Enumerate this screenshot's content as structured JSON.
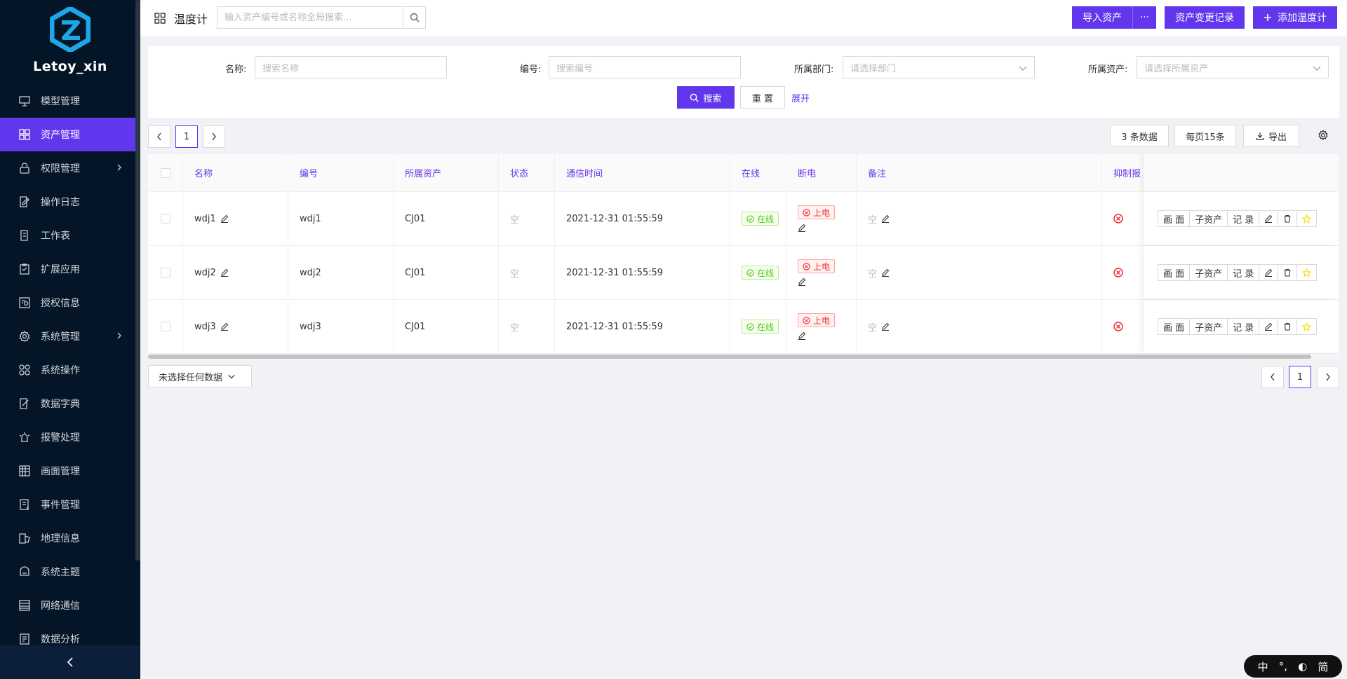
{
  "app": {
    "name": "Letoy_xin"
  },
  "sidebar": {
    "items": [
      {
        "label": "模型管理",
        "icon": "monitor-icon"
      },
      {
        "label": "资产管理",
        "icon": "grid-icon",
        "active": true
      },
      {
        "label": "权限管理",
        "icon": "lock-icon",
        "has_children": true
      },
      {
        "label": "操作日志",
        "icon": "edit-doc-icon"
      },
      {
        "label": "工作表",
        "icon": "sheet-icon"
      },
      {
        "label": "扩展应用",
        "icon": "clipboard-icon"
      },
      {
        "label": "授权信息",
        "icon": "license-icon"
      },
      {
        "label": "系统管理",
        "icon": "gear-icon",
        "has_children": true
      },
      {
        "label": "系统操作",
        "icon": "apps-icon"
      },
      {
        "label": "数据字典",
        "icon": "dictionary-icon"
      },
      {
        "label": "报警处理",
        "icon": "alarm-icon"
      },
      {
        "label": "画面管理",
        "icon": "canvas-icon"
      },
      {
        "label": "事件管理",
        "icon": "event-icon"
      },
      {
        "label": "地理信息",
        "icon": "map-icon"
      },
      {
        "label": "系统主题",
        "icon": "theme-icon"
      },
      {
        "label": "网络通信",
        "icon": "network-icon"
      },
      {
        "label": "数据分析",
        "icon": "analysis-icon"
      }
    ]
  },
  "header": {
    "title": "温度计",
    "search_placeholder": "输入资产编号或名称全局搜索...",
    "import_label": "导入资产",
    "more_label": "···",
    "change_log_label": "资产变更记录",
    "add_label": "添加温度计"
  },
  "filter": {
    "name_label": "名称:",
    "name_placeholder": "搜索名称",
    "code_label": "编号:",
    "code_placeholder": "搜索编号",
    "dept_label": "所属部门:",
    "dept_placeholder": "请选择部门",
    "asset_label": "所属资产:",
    "asset_placeholder": "请选择所属资产",
    "search_label": "搜索",
    "reset_label": "重 置",
    "expand_label": "展开"
  },
  "toolbar": {
    "page": "1",
    "count_label": "3 条数据",
    "page_size_label": "每页15条",
    "export_label": "导出"
  },
  "table": {
    "columns": [
      "名称",
      "编号",
      "所属资产",
      "状态",
      "通信时间",
      "在线",
      "断电",
      "备注",
      "抑制报"
    ],
    "rows": [
      {
        "name": "wdj1",
        "code": "wdj1",
        "asset": "CJ01",
        "status": "空",
        "time": "2021-12-31 01:55:59",
        "online": "在线",
        "power": "上电",
        "note": "空"
      },
      {
        "name": "wdj2",
        "code": "wdj2",
        "asset": "CJ01",
        "status": "空",
        "time": "2021-12-31 01:55:59",
        "online": "在线",
        "power": "上电",
        "note": "空"
      },
      {
        "name": "wdj3",
        "code": "wdj3",
        "asset": "CJ01",
        "status": "空",
        "time": "2021-12-31 01:55:59",
        "online": "在线",
        "power": "上电",
        "note": "空"
      }
    ],
    "actions": {
      "canvas": "画 面",
      "sub_asset": "子资产",
      "record": "记 录"
    }
  },
  "footer": {
    "selection_label": "未选择任何数据",
    "page": "1"
  },
  "ime": {
    "lang": "中",
    "punct": "°,",
    "mode": "简"
  },
  "colors": {
    "accent": "#6236ec",
    "sidebar_bg": "#041527",
    "success": "#52c41a",
    "danger": "#f5222d"
  }
}
